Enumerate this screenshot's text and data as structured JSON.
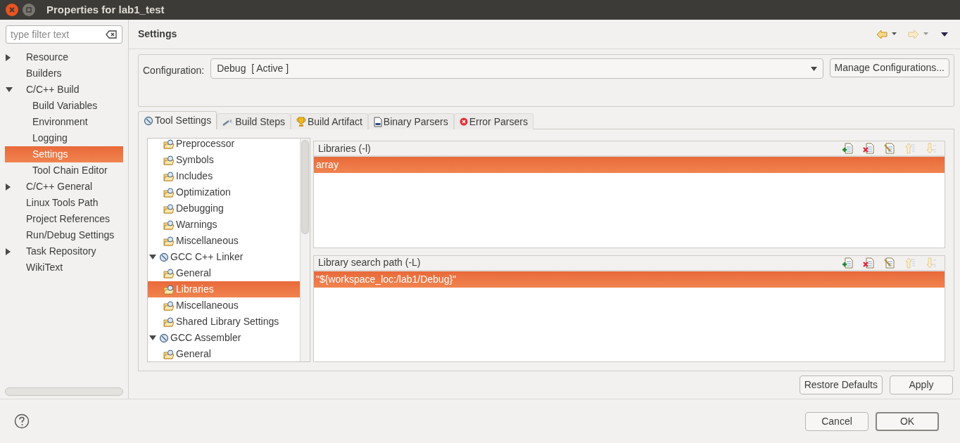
{
  "window": {
    "title": "Properties for lab1_test"
  },
  "filter": {
    "placeholder": "type filter text"
  },
  "sidebar": {
    "items": [
      {
        "label": "Resource",
        "expanded": false,
        "selected": false
      },
      {
        "label": "Builders",
        "selected": false
      },
      {
        "label": "C/C++ Build",
        "expanded": true,
        "selected": false,
        "children": [
          {
            "label": "Build Variables",
            "selected": false
          },
          {
            "label": "Environment",
            "selected": false
          },
          {
            "label": "Logging",
            "selected": false
          },
          {
            "label": "Settings",
            "selected": true
          },
          {
            "label": "Tool Chain Editor",
            "selected": false
          }
        ]
      },
      {
        "label": "C/C++ General",
        "expanded": false,
        "selected": false
      },
      {
        "label": "Linux Tools Path",
        "selected": false
      },
      {
        "label": "Project References",
        "selected": false
      },
      {
        "label": "Run/Debug Settings",
        "selected": false
      },
      {
        "label": "Task Repository",
        "expanded": false,
        "selected": false
      },
      {
        "label": "WikiText",
        "selected": false
      }
    ]
  },
  "page": {
    "title": "Settings"
  },
  "configuration": {
    "label": "Configuration:",
    "value": "Debug  [ Active ]",
    "manage_button": "Manage Configurations..."
  },
  "tabs": [
    {
      "label": "Tool Settings",
      "kind": "tool",
      "selected": true
    },
    {
      "label": "Build Steps",
      "kind": "steps",
      "selected": false
    },
    {
      "label": "Build Artifact",
      "kind": "artifact",
      "selected": false
    },
    {
      "label": "Binary Parsers",
      "kind": "binary",
      "selected": false
    },
    {
      "label": "Error Parsers",
      "kind": "error",
      "selected": false
    }
  ],
  "tool_tree": {
    "items": [
      {
        "label": "Preprocessor",
        "selected": false
      },
      {
        "label": "Symbols",
        "selected": false
      },
      {
        "label": "Includes",
        "selected": false
      },
      {
        "label": "Optimization",
        "selected": false
      },
      {
        "label": "Debugging",
        "selected": false
      },
      {
        "label": "Warnings",
        "selected": false
      },
      {
        "label": "Miscellaneous",
        "selected": false
      },
      {
        "label": "GCC C++ Linker",
        "expanded": true,
        "selected": false,
        "children": [
          {
            "label": "General",
            "selected": false
          },
          {
            "label": "Libraries",
            "selected": true
          },
          {
            "label": "Miscellaneous",
            "selected": false
          },
          {
            "label": "Shared Library Settings",
            "selected": false
          }
        ]
      },
      {
        "label": "GCC Assembler",
        "expanded": true,
        "selected": false,
        "children": [
          {
            "label": "General",
            "selected": false
          }
        ]
      }
    ]
  },
  "lists": [
    {
      "title": "Libraries (-l)",
      "items": [
        {
          "text": "array",
          "selected": true
        }
      ]
    },
    {
      "title": "Library search path (-L)",
      "items": [
        {
          "text": "\"${workspace_loc:/lab1/Debug}\"",
          "selected": true
        }
      ]
    }
  ],
  "page_buttons": [
    "Restore Defaults",
    "Apply"
  ],
  "dialog_buttons": [
    {
      "label": "Cancel",
      "default": false
    },
    {
      "label": "OK",
      "default": true
    }
  ]
}
